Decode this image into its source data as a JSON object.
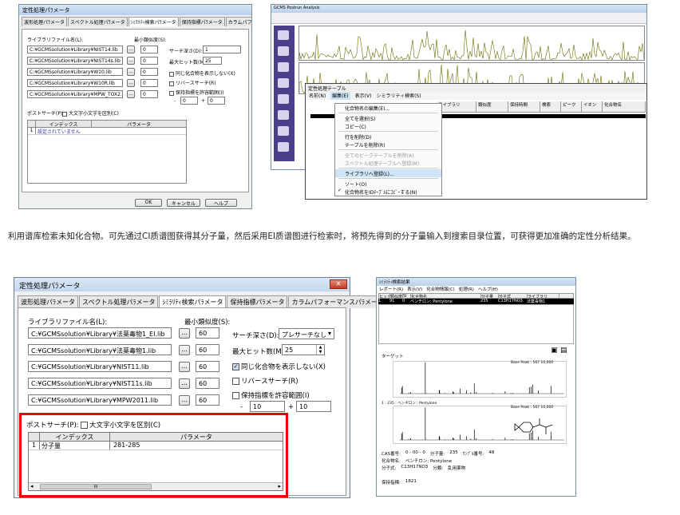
{
  "top_left_dialog": {
    "title": "定性処理パﾗメータ",
    "tabs": [
      "波形処理パﾗメータ",
      "スペクトル処理パﾗメータ",
      "ｼﾐﾗﾘﾃｨ検索パﾗメータ",
      "保持指標パﾗメータ",
      "カラムパフォーマンスパﾗメータ"
    ],
    "library_label": "ライブラリファイル名(L):",
    "min_similarity_label": "最小類似度(S):",
    "libraries": [
      "C:¥GCMSsolution¥Library¥NIST14.lib",
      "C:¥GCMSsolution¥Library¥NIST14s.lib",
      "C:¥GCMSsolution¥Library¥W10.lib",
      "C:¥GCMSsolution¥Library¥W10R.lib",
      "C:¥GCMSsolution¥Library¥MPW_TOX2.LIB"
    ],
    "similarities": [
      "0",
      "0",
      "0",
      "0",
      "0"
    ],
    "search_depth_label": "サーチ深さ(D):",
    "search_depth_value": "1",
    "max_hits_label": "最大ヒット数(M):",
    "max_hits_value": "25",
    "same_compound_label": "同じ化合物を表示しない(X)",
    "reverse_search_label": "リバースサーチ(R)",
    "retention_index_label": "保持指標を許容範囲(I)",
    "ri_low": "-",
    "ri_low_val": "0",
    "ri_plus": "+",
    "ri_high_val": "0",
    "post_search_label": "ポストサーチ(P):",
    "case_label": "大文字小文字を区別(C)",
    "index_col": "インデックス",
    "param_col": "パラメータ",
    "row_text": "設定されていません",
    "row_index": "1",
    "ok": "OK",
    "cancel": "キャンセル",
    "help": "ヘルプ"
  },
  "top_right_window": {
    "title": "GCMS Postrun Analysis",
    "sub_title": "定性処理テーブル",
    "menu_bar": [
      "名前(N)",
      "編集(E)",
      "表示(V)",
      "シミラリティ検索(S)"
    ],
    "table_headers": [
      "ライブラリ",
      "類似度",
      "保持時間",
      "検索",
      "ピーク",
      "イオン",
      "化合物名"
    ],
    "context_menu": [
      {
        "label": "化合物名の編集(E)...",
        "state": "normal"
      },
      {
        "label": "全てを選択(S)",
        "state": "normal"
      },
      {
        "label": "コピー(C)",
        "state": "normal"
      },
      {
        "label": "行を削除(D)",
        "state": "normal"
      },
      {
        "label": "テーブルを削除(R)",
        "state": "normal"
      },
      {
        "label": "全てのピークテーブルを削除(A)",
        "state": "disabled"
      },
      {
        "label": "スペクトル処理テーブルへ登録(M)",
        "state": "disabled"
      },
      {
        "label": "ライブラリへ登録(L)...",
        "state": "selected"
      },
      {
        "label": "ソート(O)",
        "state": "normal"
      },
      {
        "label": "化合物名をIDﾃｰﾌﾞﾙにｺﾋﾟｰする(N)",
        "state": "checked"
      }
    ]
  },
  "paragraph": "利用谱库检索未知化合物。可先通过CI质谱图获得其分子量，然后采用EI质谱图进行检索时，将预先得到的分子量输入到搜索目录位置，可获得更加准确的定性分析结果。",
  "main_dialog": {
    "title": "定性処理パﾗメータ",
    "tabs": [
      "波形処理パﾗメータ",
      "スペクトル処理パﾗメータ",
      "ｼﾐﾗﾘﾃｨ検索パﾗメータ",
      "保持指標パﾗメータ",
      "カラムパフォーマンスパﾗメータ"
    ],
    "library_label": "ライブラリファイル名(L):",
    "min_similarity_label": "最小類似度(S):",
    "libraries": [
      "C:¥GCMSsolution¥Library¥法薬毒物1_EI.lib",
      "C:¥GCMSsolution¥Library¥法薬毒物1.lib",
      "C:¥GCMSsolution¥Library¥NIST11.lib",
      "C:¥GCMSsolution¥Library¥NIST11s.lib",
      "C:¥GCMSsolution¥Library¥MPW2011.lib"
    ],
    "similarities": [
      "60",
      "60",
      "60",
      "60",
      "60"
    ],
    "browse": "...",
    "search_depth_label": "サーチ深さ(D):",
    "search_depth_value": "プレサーチなし",
    "max_hits_label": "最大ヒット数(M):",
    "max_hits_value": "25",
    "same_compound_label": "同じ化合物を表示しない(X)",
    "reverse_search_label": "リバースサーチ(R)",
    "retention_index_label": "保持指標を許容範囲(I)",
    "ri_minus": "-",
    "ri_low": "10",
    "ri_plus": "+",
    "ri_high": "10",
    "post_search_label": "ポストサーチ(P):",
    "case_label": "大文字小文字を区別(C)",
    "index_col": "インデックス",
    "param_col": "パラメータ",
    "row_num": "1",
    "row_index": "分子量",
    "row_param": "281-285",
    "scroll_mark": "III"
  },
  "result_window": {
    "title": "ｼﾐﾗﾘﾃｨ検索結果",
    "menu": [
      "レポート(R)",
      "表示(V)",
      "化合物情報(C)",
      "処理(R)",
      "ヘルプ(H)"
    ],
    "headers": [
      "ヒット",
      "類似度",
      "SI",
      "化合物名",
      "分子量",
      "分子式",
      "ライブラリ"
    ],
    "row": [
      "1",
      "91",
      "0",
      "ベンチロン; Pentylone",
      "235",
      "C13H17NO3",
      "法薬毒物1"
    ],
    "spectrum_label": "ターゲット",
    "top_chart_label": "Base Peak : 567 10,000",
    "bottom_chart_label": "Base Peak : 567 10,000",
    "hit_label": "1 : 235 : ベンチロン : Pentylone",
    "cas_label": "CAS番号:",
    "cas_value": "0 - 00 - 0",
    "mw_label": "分子量:",
    "mw_value": "235",
    "rt_label": "ｻﾝﾌﾟﾙ番号:",
    "rt_value": "48",
    "name_label": "化合物名:",
    "name_value": "ベンチロン; Pentylone",
    "formula_label": "分子式:",
    "formula_value": "C13H17NO3",
    "class_label": "分類:",
    "class_value": "乱用薬物",
    "ri_label": "保持指標:",
    "ri_value": "1821"
  },
  "colors": {
    "accent_red": "#e00000",
    "title_grad": "#c3d6ee",
    "selection": "#cde3f7",
    "spectrum": "#6b6b00"
  }
}
